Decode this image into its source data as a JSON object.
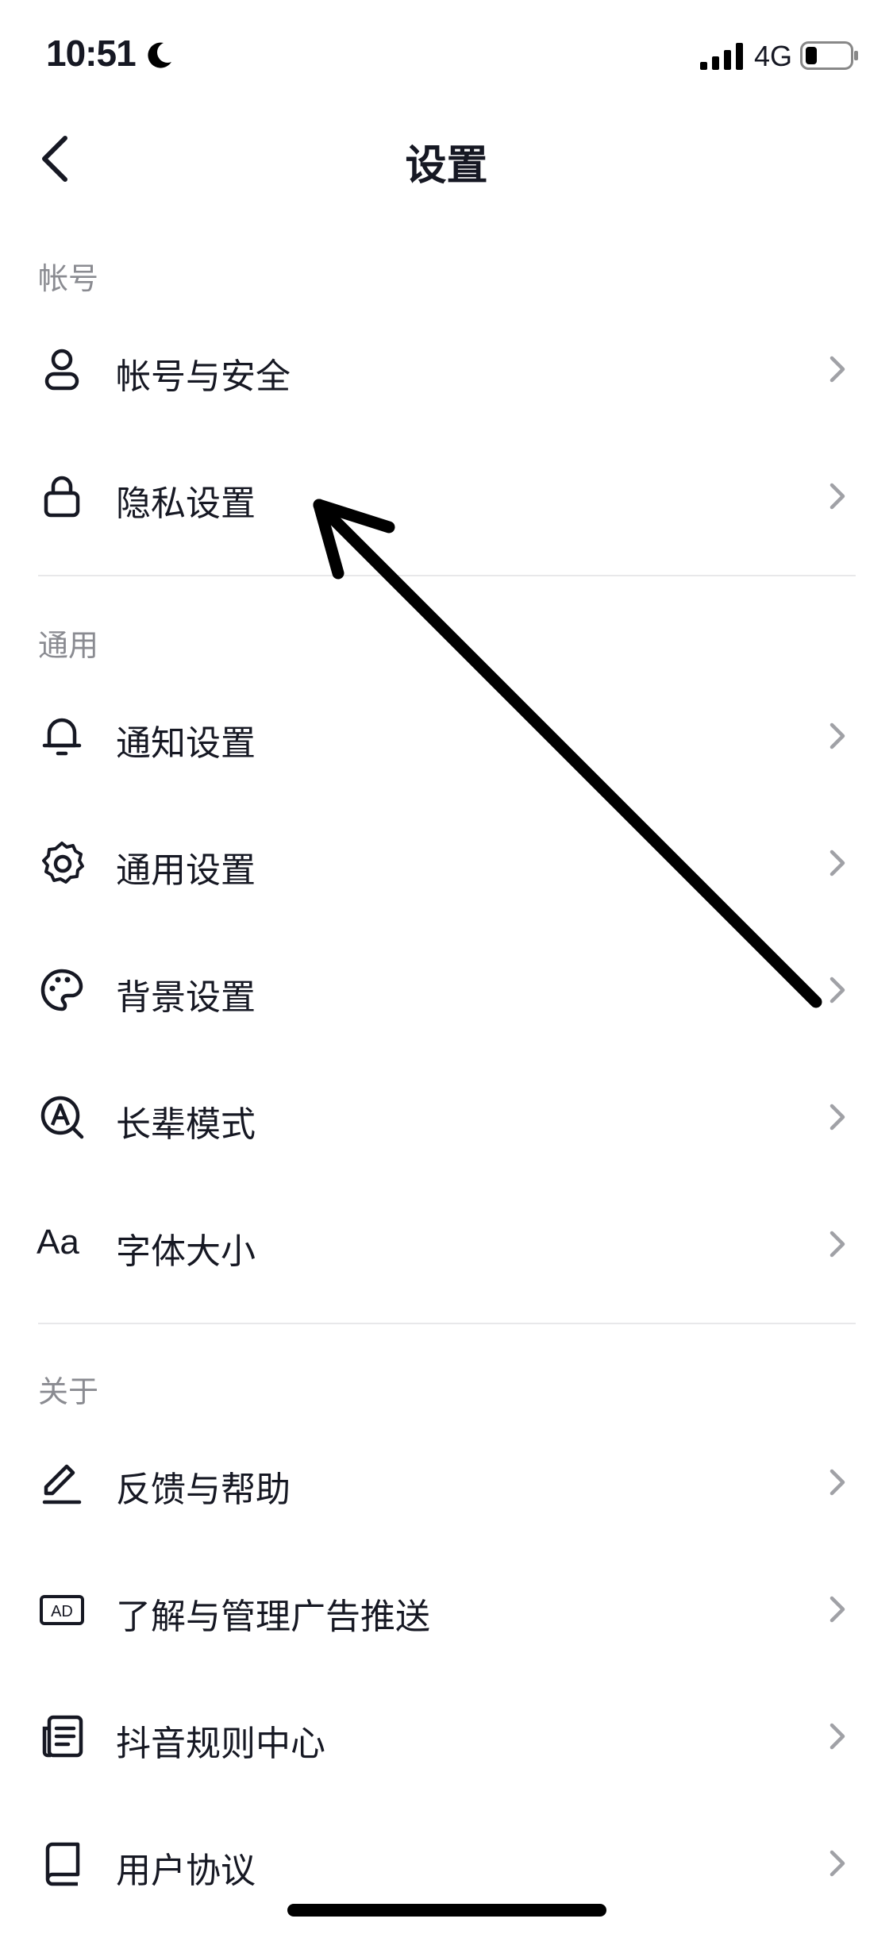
{
  "status_bar": {
    "time": "10:51",
    "network": "4G",
    "icons": [
      "moon-icon",
      "signal-icon",
      "battery-icon"
    ]
  },
  "header": {
    "title": "设置",
    "back_icon": "chevron-left-icon"
  },
  "sections": [
    {
      "title": "帐号",
      "items": [
        {
          "label": "帐号与安全",
          "icon": "user-icon"
        },
        {
          "label": "隐私设置",
          "icon": "lock-icon"
        }
      ]
    },
    {
      "title": "通用",
      "items": [
        {
          "label": "通知设置",
          "icon": "bell-icon"
        },
        {
          "label": "通用设置",
          "icon": "gear-icon"
        },
        {
          "label": "背景设置",
          "icon": "palette-icon"
        },
        {
          "label": "长辈模式",
          "icon": "elder-mode-icon"
        },
        {
          "label": "字体大小",
          "icon": "font-size-icon",
          "icon_text": "Aa"
        }
      ]
    },
    {
      "title": "关于",
      "items": [
        {
          "label": "反馈与帮助",
          "icon": "edit-icon"
        },
        {
          "label": "了解与管理广告推送",
          "icon": "ad-icon",
          "icon_text": "AD"
        },
        {
          "label": "抖音规则中心",
          "icon": "document-icon"
        },
        {
          "label": "用户协议",
          "icon": "book-icon"
        }
      ]
    }
  ],
  "colors": {
    "text": "#161823",
    "section_header": "#8a8b91",
    "chevron": "#a0a1a6",
    "divider": "#e8e8ea",
    "arrow": "#000000"
  }
}
